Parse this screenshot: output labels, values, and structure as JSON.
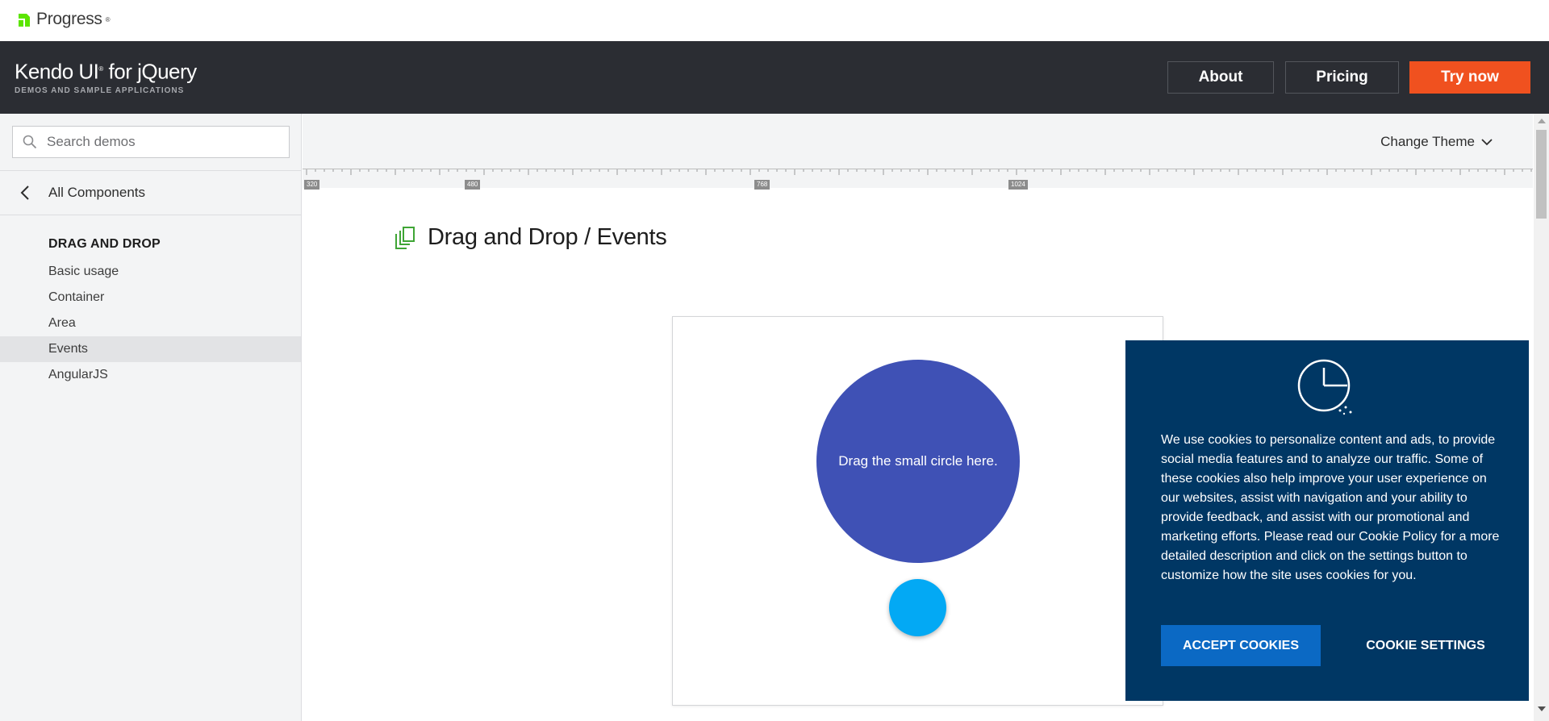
{
  "topbar": {
    "logo_text": "Progress"
  },
  "header": {
    "brand_title": "Kendo UI",
    "brand_suffix": " for jQuery",
    "brand_subtitle": "DEMOS AND SAMPLE APPLICATIONS",
    "about_label": "About",
    "pricing_label": "Pricing",
    "try_label": "Try now",
    "accent_color": "#f0511f"
  },
  "sidebar": {
    "search_placeholder": "Search demos",
    "all_components_label": "All Components",
    "section_title": "DRAG AND DROP",
    "items": [
      {
        "label": "Basic usage",
        "active": false
      },
      {
        "label": "Container",
        "active": false
      },
      {
        "label": "Area",
        "active": false
      },
      {
        "label": "Events",
        "active": true
      },
      {
        "label": "AngularJS",
        "active": false
      }
    ]
  },
  "content": {
    "change_theme_label": "Change Theme",
    "ruler_labels": [
      "320",
      "480",
      "768",
      "1024"
    ],
    "demo_title": "Drag and Drop / Events",
    "drop_target_text": "Drag the small circle here."
  },
  "cookie": {
    "message": "We use cookies to personalize content and ads, to provide social media features and to analyze our traffic. Some of these cookies also help improve your user experience on our websites, assist with navigation and your ability to provide feedback, and assist with our promotional and marketing efforts. Please read our Cookie Policy for a more detailed description and click on the settings button to customize how the site uses cookies for you.",
    "accept_label": "ACCEPT COOKIES",
    "settings_label": "COOKIE SETTINGS",
    "background_color": "#003764"
  }
}
